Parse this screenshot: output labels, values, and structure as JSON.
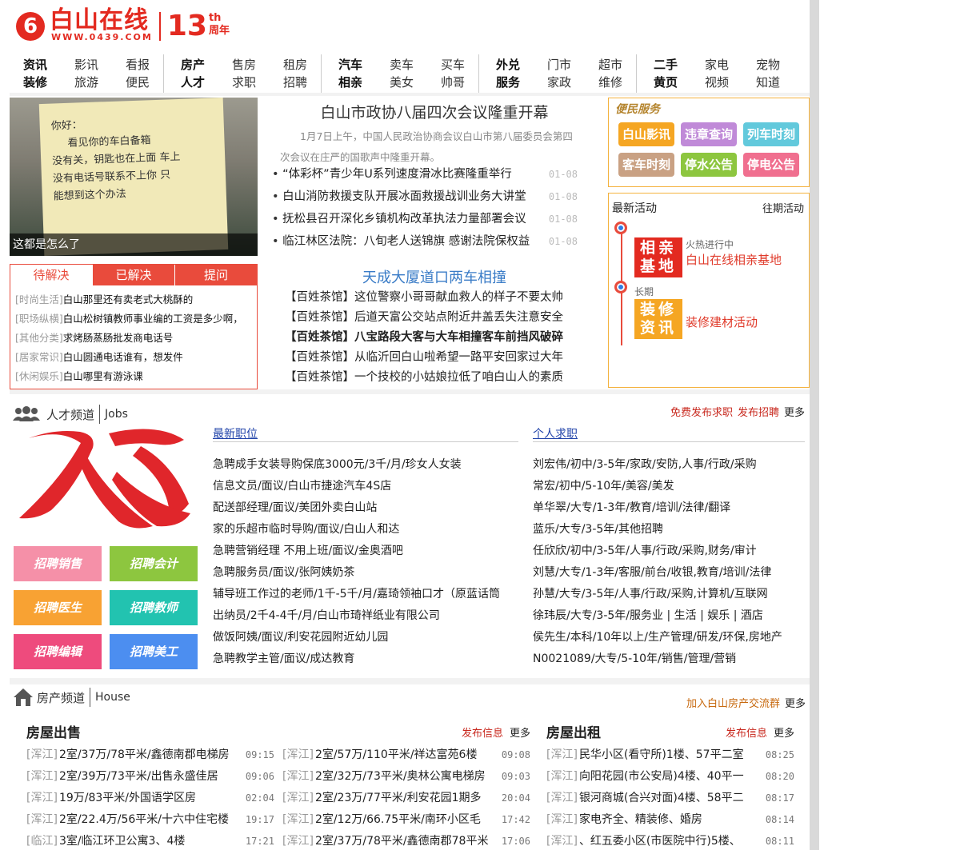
{
  "header": {
    "logo_icon": "6",
    "logo_name": "白山在线",
    "logo_url": "WWW.0439.COM",
    "anniv_num": "13",
    "anniv_sup": "th",
    "anniv_label": "周年"
  },
  "nav": [
    [
      [
        "资讯",
        true
      ],
      [
        "影讯",
        false
      ],
      [
        "看报",
        false
      ],
      [
        "装修",
        true
      ],
      [
        "旅游",
        false
      ],
      [
        "便民",
        false
      ]
    ],
    [
      [
        "房产",
        true
      ],
      [
        "售房",
        false
      ],
      [
        "租房",
        false
      ],
      [
        "人才",
        true
      ],
      [
        "求职",
        false
      ],
      [
        "招聘",
        false
      ]
    ],
    [
      [
        "汽车",
        true
      ],
      [
        "卖车",
        false
      ],
      [
        "买车",
        false
      ],
      [
        "相亲",
        true
      ],
      [
        "美女",
        false
      ],
      [
        "帅哥",
        false
      ]
    ],
    [
      [
        "外兑",
        true
      ],
      [
        "门市",
        false
      ],
      [
        "超市",
        false
      ],
      [
        "服务",
        true
      ],
      [
        "家政",
        false
      ],
      [
        "维修",
        false
      ]
    ],
    [
      [
        "二手",
        true
      ],
      [
        "家电",
        false
      ],
      [
        "宠物",
        false
      ],
      [
        "黄页",
        true
      ],
      [
        "视频",
        false
      ],
      [
        "知道",
        false
      ]
    ]
  ],
  "hero": {
    "caption": "这都是怎么了",
    "note_lines": [
      "你好：",
      "看见你的车白备箱",
      "没有关，钥匙也在上面 车上",
      "没有电话号联系不上你 只",
      "能想到这个办法"
    ]
  },
  "qa": {
    "tabs": [
      "待解决",
      "已解决",
      "提问"
    ],
    "items": [
      {
        "cat": "[时尚生活]",
        "text": "白山那里还有卖老式大桃酥的"
      },
      {
        "cat": "[职场纵横]",
        "text": "白山松树镇教师事业编的工资是多少啊，"
      },
      {
        "cat": "[其他分类]",
        "text": "求烤肠蒸肠批发商电话号"
      },
      {
        "cat": "[居家常识]",
        "text": "白山圆通电话谁有，想发件"
      },
      {
        "cat": "[休闲娱乐]",
        "text": "白山哪里有游泳课"
      }
    ]
  },
  "news": {
    "headline": "白山市政协八届四次会议隆重开幕",
    "summary": "1月7日上午，中国人民政治协商会议白山市第八届委员会第四次会议在庄严的国歌声中隆重开幕。",
    "items": [
      {
        "title": "“体彩杯”青少年U系列速度滑冰比赛隆重举行",
        "date": "01-08"
      },
      {
        "title": "白山消防救援支队开展冰面救援战训业务大讲堂",
        "date": "01-08"
      },
      {
        "title": "抚松县召开深化乡镇机构改革执法力量部署会议",
        "date": "01-08"
      },
      {
        "title": "临江林区法院：八旬老人送锦旗 感谢法院保权益",
        "date": "01-08"
      }
    ],
    "headline2": "天成大厦道口两车相撞",
    "tea": [
      {
        "text": "【百姓茶馆】这位警察小哥哥献血救人的样子不要太帅",
        "bold": false
      },
      {
        "text": "【百姓茶馆】后道天富公交站点附近井盖丢失注意安全",
        "bold": false
      },
      {
        "text": "【百姓茶馆】八宝路段大客与大车相撞客车前挡风破碎",
        "bold": true
      },
      {
        "text": "【百姓茶馆】从临沂回白山啦希望一路平安回家过大年",
        "bold": false
      },
      {
        "text": "【百姓茶馆】一个技校的小姑娘拉低了咱白山人的素质",
        "bold": false
      }
    ]
  },
  "services": {
    "title": "便民服务",
    "items": [
      {
        "label": "白山影讯",
        "color": "#f5a623"
      },
      {
        "label": "违章查询",
        "color": "#c08ad8"
      },
      {
        "label": "列车时刻",
        "color": "#62c9dc"
      },
      {
        "label": "客车时刻",
        "color": "#c9a183"
      },
      {
        "label": "停水公告",
        "color": "#8dc63f"
      },
      {
        "label": "停电公告",
        "color": "#f06f8f"
      }
    ]
  },
  "activities": {
    "title": "最新活动",
    "past": "往期活动",
    "items": [
      {
        "badge": "相亲基地",
        "status": "火热进行中",
        "name": "白山在线相亲基地",
        "color": "#e32a20"
      },
      {
        "badge": "装修资讯",
        "status": "长期",
        "name": "装修建材活动",
        "color": "#f5a623"
      }
    ]
  },
  "talent": {
    "title": "人才频道",
    "en": "Jobs",
    "link1": "免费发布求职",
    "link2": "发布招聘",
    "more": "更多",
    "logo_text": "人才",
    "buttons": [
      {
        "label": "招聘销售",
        "color": "#f590a8"
      },
      {
        "label": "招聘会计",
        "color": "#8dc63f"
      },
      {
        "label": "招聘医生",
        "color": "#f8a233"
      },
      {
        "label": "招聘教师",
        "color": "#22c3b0"
      },
      {
        "label": "招聘编辑",
        "color": "#ee4b7d"
      },
      {
        "label": "招聘美工",
        "color": "#4c8ef0"
      }
    ],
    "latest_title": "最新职位",
    "latest": [
      "急聘成手女装导购保底3000元/3千/月/珍女人女装",
      "信息文员/面议/白山市捷途汽车4S店",
      "配送部经理/面议/美团外卖白山站",
      "家的乐超市临时导购/面议/白山人和达",
      "急聘营销经理 不用上班/面议/金奥酒吧",
      "急聘服务员/面议/张阿姨奶茶",
      "辅导班工作过的老师/1千-5千/月/嘉琦领袖口才（原蓝话筒",
      "出纳员/2千4-4千/月/白山市琦祥纸业有限公司",
      "做饭阿姨/面议/利安花园附近幼儿园",
      "急聘教学主管/面议/成达教育"
    ],
    "seek_title": "个人求职",
    "seek": [
      "刘宏伟/初中/3-5年/家政/安防,人事/行政/采购",
      "常宏/初中/5-10年/美容/美发",
      "单华翠/大专/1-3年/教育/培训/法律/翻译",
      "蓝乐/大专/3-5年/其他招聘",
      "任欣欣/初中/3-5年/人事/行政/采购,财务/审计",
      "刘慧/大专/1-3年/客服/前台/收银,教育/培训/法律",
      "孙慧/大专/3-5年/人事/行政/采购,计算机/互联网",
      "徐玮辰/大专/3-5年/服务业 | 生活 | 娱乐 | 酒店",
      "侯先生/本科/10年以上/生产管理/研发/环保,房地产",
      "N0021089/大专/5-10年/销售/管理/营销"
    ]
  },
  "house": {
    "title": "房产频道",
    "en": "House",
    "join": "加入白山房产交流群",
    "more": "更多",
    "sale_title": "房屋出售",
    "rent_title": "房屋出租",
    "publish": "发布信息",
    "sale_left": [
      {
        "loc": "[浑江]",
        "title": "2室/37万/78平米/鑫德南郡电梯房",
        "time": "09:15"
      },
      {
        "loc": "[浑江]",
        "title": "2室/39万/73平米/出售永盛佳居",
        "time": "09:06"
      },
      {
        "loc": "[浑江]",
        "title": "19万/83平米/外国语学区房",
        "time": "02:04"
      },
      {
        "loc": "[浑江]",
        "title": "2室/22.4万/56平米/十六中住宅楼",
        "time": "19:17"
      },
      {
        "loc": "[临江]",
        "title": "3室/临江环卫公寓3、4楼",
        "time": "17:21"
      }
    ],
    "sale_right": [
      {
        "loc": "[浑江]",
        "title": "2室/57万/110平米/祥达富苑6楼",
        "time": "09:08"
      },
      {
        "loc": "[浑江]",
        "title": "2室/32万/73平米/奥林公寓电梯房",
        "time": "09:03"
      },
      {
        "loc": "[浑江]",
        "title": "2室/23万/77平米/利安花园1期多",
        "time": "20:04"
      },
      {
        "loc": "[浑江]",
        "title": "2室/12万/66.75平米/南环小区毛",
        "time": "17:42"
      },
      {
        "loc": "[浑江]",
        "title": "2室/37万/78平米/鑫德南郡78平米",
        "time": "17:06"
      }
    ],
    "rent": [
      {
        "loc": "[浑江]",
        "title": "民华小区(看守所)1楼、57平二室",
        "time": "08:25"
      },
      {
        "loc": "[浑江]",
        "title": "向阳花园(市公安局)4楼、40平一",
        "time": "08:20"
      },
      {
        "loc": "[浑江]",
        "title": "银河商城(合兴对面)4楼、58平二",
        "time": "08:17"
      },
      {
        "loc": "[浑江]",
        "title": "家电齐全、精装修、婚房",
        "time": "08:14"
      },
      {
        "loc": "[浑江]",
        "title": "、红五委小区(市医院中行)5楼、",
        "time": "08:11"
      }
    ]
  }
}
